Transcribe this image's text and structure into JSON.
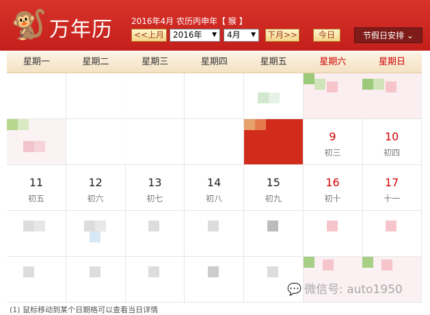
{
  "header": {
    "app_title": "万年历",
    "date_info": "2016年4月 农历丙申年【 猴 】",
    "prev_month": "<<上月",
    "year_select": "2016年",
    "month_select": "4月",
    "next_month": "下月>>",
    "today": "今日",
    "holiday": "节假日安排"
  },
  "weekdays": [
    "星期一",
    "星期二",
    "星期三",
    "星期四",
    "星期五",
    "星期六",
    "星期日"
  ],
  "row2": [
    {
      "day": "9",
      "lunar": "初三"
    },
    {
      "day": "10",
      "lunar": "初四"
    }
  ],
  "row3": [
    {
      "day": "11",
      "lunar": "初五"
    },
    {
      "day": "12",
      "lunar": "初六"
    },
    {
      "day": "13",
      "lunar": "初七"
    },
    {
      "day": "14",
      "lunar": "初八"
    },
    {
      "day": "15",
      "lunar": "初九"
    },
    {
      "day": "16",
      "lunar": "初十"
    },
    {
      "day": "17",
      "lunar": "十一"
    }
  ],
  "footer_note": "(1) 鼠标移动到某个日期格可以查看当日详情",
  "watermark": "微信号: auto1950",
  "colors": {
    "header_red": "#c41f1b",
    "weekend_red": "#d40000",
    "holiday_btn": "#7f1c1a"
  }
}
